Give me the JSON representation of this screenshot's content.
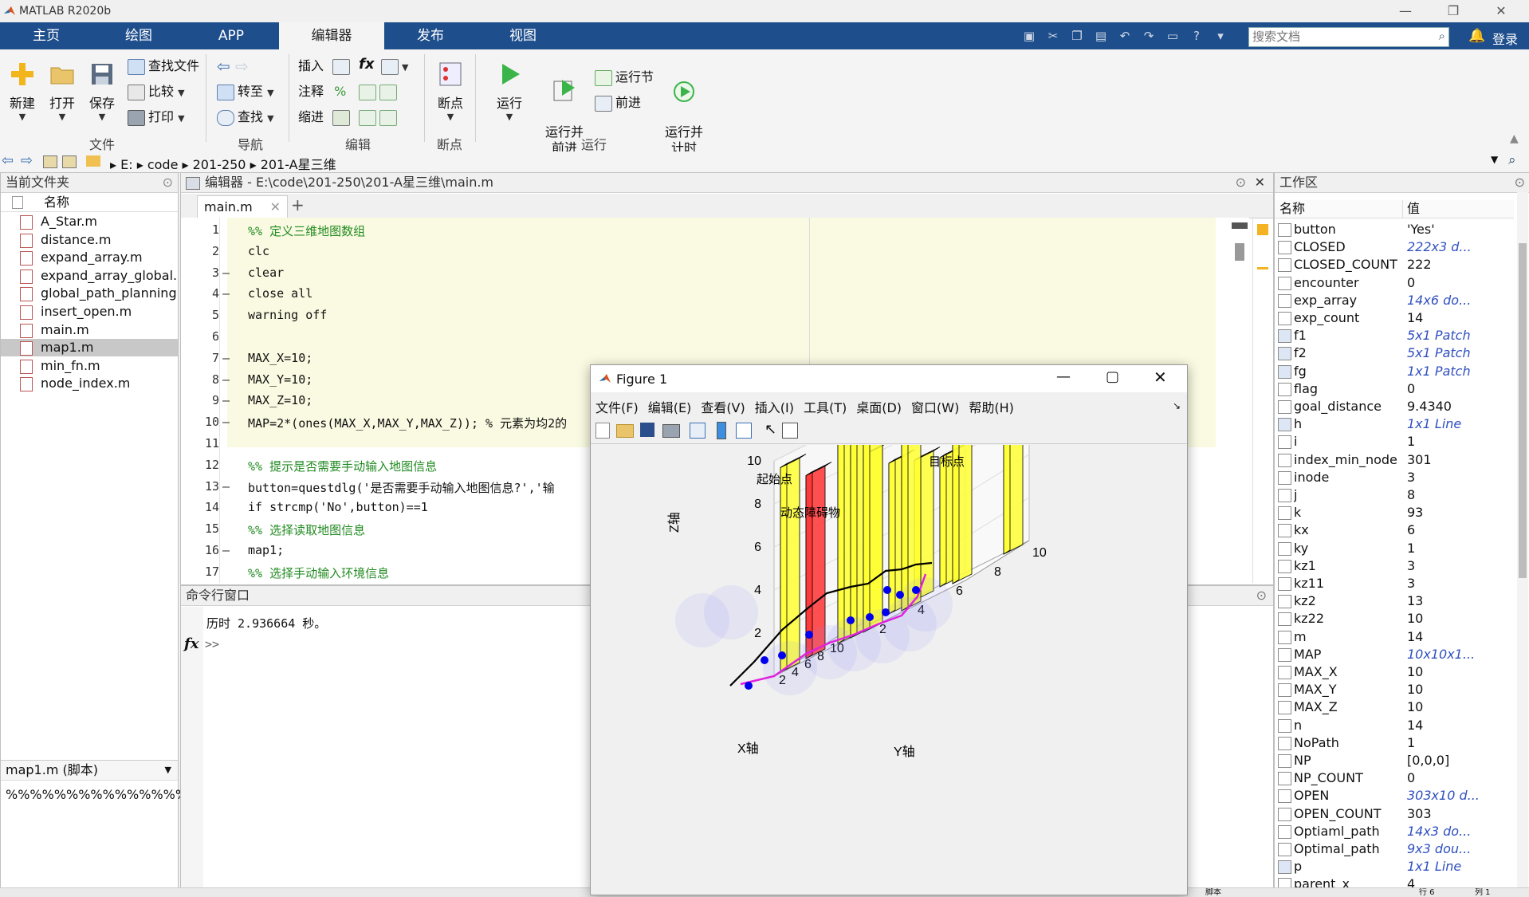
{
  "app": {
    "title": "MATLAB R2020b",
    "window_controls": [
      "—",
      "❐",
      "✕"
    ]
  },
  "ribbon_tabs": [
    "主页",
    "绘图",
    "APP",
    "编辑器",
    "发布",
    "视图"
  ],
  "active_tab": "编辑器",
  "search": {
    "placeholder": "搜索文档"
  },
  "login": "登录",
  "ribbon": {
    "file_group": {
      "new": "新建",
      "open": "打开",
      "save": "保存",
      "find_files": "查找文件",
      "compare": "比较",
      "print": "打印",
      "label": "文件"
    },
    "nav_group": {
      "goto": "转至",
      "find": "查找",
      "label": "导航"
    },
    "edit_group": {
      "insert": "插入",
      "comment": "注释",
      "indent": "缩进",
      "fx": "fx",
      "label": "编辑"
    },
    "breakpoint_group": {
      "breakpoints": "断点",
      "label": "断点"
    },
    "run_group": {
      "run": "运行",
      "run_advance": "运行并\n前进",
      "run_section": "运行节",
      "advance": "前进",
      "run_time": "运行并\n计时",
      "label": "运行"
    }
  },
  "address": [
    "E:",
    "code",
    "201-250",
    "201-A星三维"
  ],
  "current_folder": {
    "title": "当前文件夹",
    "col_name": "名称",
    "files": [
      "A_Star.m",
      "distance.m",
      "expand_array.m",
      "expand_array_global.m",
      "global_path_planning.m",
      "insert_open.m",
      "main.m",
      "map1.m",
      "min_fn.m",
      "node_index.m"
    ],
    "selected": "map1.m",
    "detail_title": "map1.m  (脚本)",
    "detail_text": "%%%%%%%%%%%%%%%%"
  },
  "editor": {
    "title": "编辑器 - E:\\code\\201-250\\201-A星三维\\main.m",
    "tab": "main.m",
    "lines": [
      {
        "n": "1",
        "dash": "",
        "text": "%% 定义三维地图数组",
        "type": "cmt"
      },
      {
        "n": "2",
        "dash": "",
        "text": "clc",
        "type": "plain"
      },
      {
        "n": "3",
        "dash": "—",
        "text": "clear",
        "type": "plain"
      },
      {
        "n": "4",
        "dash": "—",
        "text": "close all",
        "type": "plain"
      },
      {
        "n": "5",
        "dash": "",
        "text": "warning off",
        "type": "plain"
      },
      {
        "n": "6",
        "dash": "",
        "text": "",
        "type": "plain"
      },
      {
        "n": "7",
        "dash": "—",
        "text": "MAX_X=10;",
        "type": "plain"
      },
      {
        "n": "8",
        "dash": "—",
        "text": "MAX_Y=10;",
        "type": "plain"
      },
      {
        "n": "9",
        "dash": "—",
        "text": "MAX_Z=10;",
        "type": "plain"
      },
      {
        "n": "10",
        "dash": "—",
        "text": "MAP=2*(ones(MAX_X,MAX_Y,MAX_Z)); % 元素为均2的",
        "type": "plain"
      },
      {
        "n": "11",
        "dash": "",
        "text": "",
        "type": "plain"
      },
      {
        "n": "12",
        "dash": "",
        "text": "%% 提示是否需要手动输入地图信息",
        "type": "cmt"
      },
      {
        "n": "13",
        "dash": "—",
        "text": "button=questdlg('是否需要手动输入地图信息?','输",
        "type": "plain"
      },
      {
        "n": "14",
        "dash": "",
        "text": "if strcmp('No',button)==1",
        "type": "plain"
      },
      {
        "n": "15",
        "dash": "",
        "text": "%% 选择读取地图信息",
        "type": "cmt"
      },
      {
        "n": "16",
        "dash": "—",
        "text": "map1;",
        "type": "plain"
      },
      {
        "n": "17",
        "dash": "",
        "text": "%% 选择手动输入环境信息",
        "type": "cmt"
      }
    ]
  },
  "command": {
    "title": "命令行窗口",
    "output": "历时 2.936664 秒。",
    "prompt": ">>"
  },
  "workspace": {
    "title": "工作区",
    "col_name": "名称",
    "col_value": "值",
    "vars": [
      {
        "name": "button",
        "value": "'Yes'",
        "it": false,
        "obj": false
      },
      {
        "name": "CLOSED",
        "value": "222x3 d...",
        "it": true,
        "obj": false
      },
      {
        "name": "CLOSED_COUNT",
        "value": "222",
        "it": false,
        "obj": false
      },
      {
        "name": "encounter",
        "value": "0",
        "it": false,
        "obj": false
      },
      {
        "name": "exp_array",
        "value": "14x6 do...",
        "it": true,
        "obj": false
      },
      {
        "name": "exp_count",
        "value": "14",
        "it": false,
        "obj": false
      },
      {
        "name": "f1",
        "value": "5x1 Patch",
        "it": true,
        "obj": true
      },
      {
        "name": "f2",
        "value": "5x1 Patch",
        "it": true,
        "obj": true
      },
      {
        "name": "fg",
        "value": "1x1 Patch",
        "it": true,
        "obj": true
      },
      {
        "name": "flag",
        "value": "0",
        "it": false,
        "obj": false
      },
      {
        "name": "goal_distance",
        "value": "9.4340",
        "it": false,
        "obj": false
      },
      {
        "name": "h",
        "value": "1x1 Line",
        "it": true,
        "obj": true
      },
      {
        "name": "i",
        "value": "1",
        "it": false,
        "obj": false
      },
      {
        "name": "index_min_node",
        "value": "301",
        "it": false,
        "obj": false
      },
      {
        "name": "inode",
        "value": "3",
        "it": false,
        "obj": false
      },
      {
        "name": "j",
        "value": "8",
        "it": false,
        "obj": false
      },
      {
        "name": "k",
        "value": "93",
        "it": false,
        "obj": false
      },
      {
        "name": "kx",
        "value": "6",
        "it": false,
        "obj": false
      },
      {
        "name": "ky",
        "value": "1",
        "it": false,
        "obj": false
      },
      {
        "name": "kz1",
        "value": "3",
        "it": false,
        "obj": false
      },
      {
        "name": "kz11",
        "value": "3",
        "it": false,
        "obj": false
      },
      {
        "name": "kz2",
        "value": "13",
        "it": false,
        "obj": false
      },
      {
        "name": "kz22",
        "value": "10",
        "it": false,
        "obj": false
      },
      {
        "name": "m",
        "value": "14",
        "it": false,
        "obj": false
      },
      {
        "name": "MAP",
        "value": "10x10x1...",
        "it": true,
        "obj": false
      },
      {
        "name": "MAX_X",
        "value": "10",
        "it": false,
        "obj": false
      },
      {
        "name": "MAX_Y",
        "value": "10",
        "it": false,
        "obj": false
      },
      {
        "name": "MAX_Z",
        "value": "10",
        "it": false,
        "obj": false
      },
      {
        "name": "n",
        "value": "14",
        "it": false,
        "obj": false
      },
      {
        "name": "NoPath",
        "value": "1",
        "it": false,
        "obj": false
      },
      {
        "name": "NP",
        "value": "[0,0,0]",
        "it": false,
        "obj": false
      },
      {
        "name": "NP_COUNT",
        "value": "0",
        "it": false,
        "obj": false
      },
      {
        "name": "OPEN",
        "value": "303x10 d...",
        "it": true,
        "obj": false
      },
      {
        "name": "OPEN_COUNT",
        "value": "303",
        "it": false,
        "obj": false
      },
      {
        "name": "Optiaml_path",
        "value": "14x3 do...",
        "it": true,
        "obj": false
      },
      {
        "name": "Optimal_path",
        "value": "9x3 dou...",
        "it": true,
        "obj": false
      },
      {
        "name": "p",
        "value": "1x1 Line",
        "it": true,
        "obj": true
      },
      {
        "name": "parent_x",
        "value": "4",
        "it": false,
        "obj": false
      }
    ]
  },
  "status": {
    "script": "脚本",
    "row": "行 6",
    "col": "列 1"
  },
  "figure": {
    "title": "Figure 1",
    "menus": [
      "文件(F)",
      "编辑(E)",
      "查看(V)",
      "插入(I)",
      "工具(T)",
      "桌面(D)",
      "窗口(W)",
      "帮助(H)"
    ],
    "plot": {
      "xlabel": "X轴",
      "ylabel": "Y轴",
      "zlabel": "Z轴",
      "start_label": "起始点",
      "goal_label": "目标点",
      "dyn_label": "动态障碍物",
      "zticks": [
        "2",
        "4",
        "6",
        "8",
        "10"
      ],
      "xticks": [
        "2",
        "4",
        "6",
        "8",
        "10"
      ],
      "yticks": [
        "2",
        "4",
        "6",
        "8",
        "10"
      ],
      "colors": {
        "obstacle": "#ffff33",
        "dynamic": "#ff3333",
        "path": "#000000",
        "alt_path": "#e020e0",
        "node": "#0000ee"
      }
    }
  }
}
